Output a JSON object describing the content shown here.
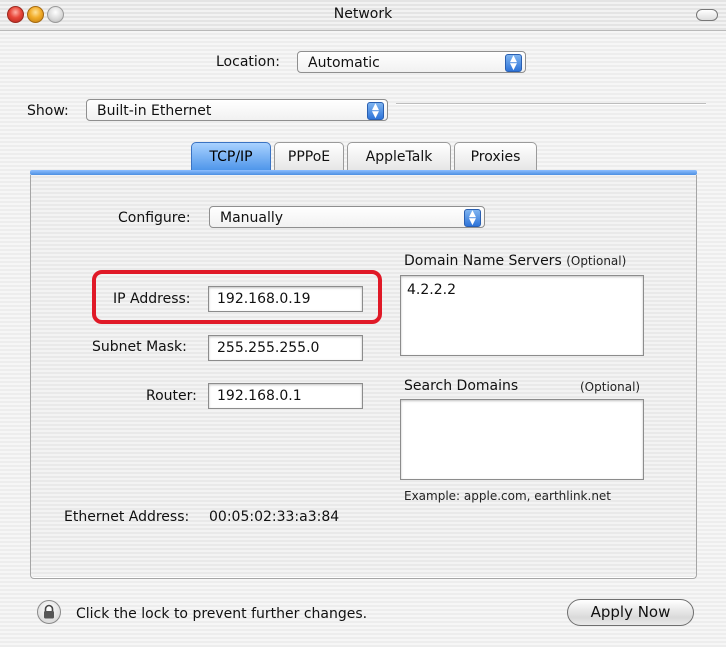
{
  "window": {
    "title": "Network"
  },
  "location": {
    "label": "Location:",
    "value": "Automatic"
  },
  "show": {
    "label": "Show:",
    "value": "Built-in Ethernet"
  },
  "tabs": [
    {
      "label": "TCP/IP",
      "active": true
    },
    {
      "label": "PPPoE",
      "active": false
    },
    {
      "label": "AppleTalk",
      "active": false
    },
    {
      "label": "Proxies",
      "active": false
    }
  ],
  "tcpip": {
    "configure_label": "Configure:",
    "configure_value": "Manually",
    "ip_label": "IP Address:",
    "ip_value": "192.168.0.19",
    "subnet_label": "Subnet Mask:",
    "subnet_value": "255.255.255.0",
    "router_label": "Router:",
    "router_value": "192.168.0.1",
    "dns_label": "Domain Name Servers",
    "dns_optional": "(Optional)",
    "dns_value": "4.2.2.2",
    "search_label": "Search Domains",
    "search_optional": "(Optional)",
    "search_value": "",
    "example_text": "Example: apple.com, earthlink.net",
    "ethernet_label": "Ethernet Address:",
    "ethernet_value": "00:05:02:33:a3:84"
  },
  "footer": {
    "lock_text": "Click the lock to prevent further changes.",
    "apply_label": "Apply Now"
  },
  "colors": {
    "highlight": "#e01927",
    "accent": "#4f96ea"
  },
  "icons": [
    "close-icon",
    "minimize-icon",
    "zoom-icon",
    "toolbar-toggle-icon",
    "updown-arrows-icon",
    "lock-icon"
  ]
}
